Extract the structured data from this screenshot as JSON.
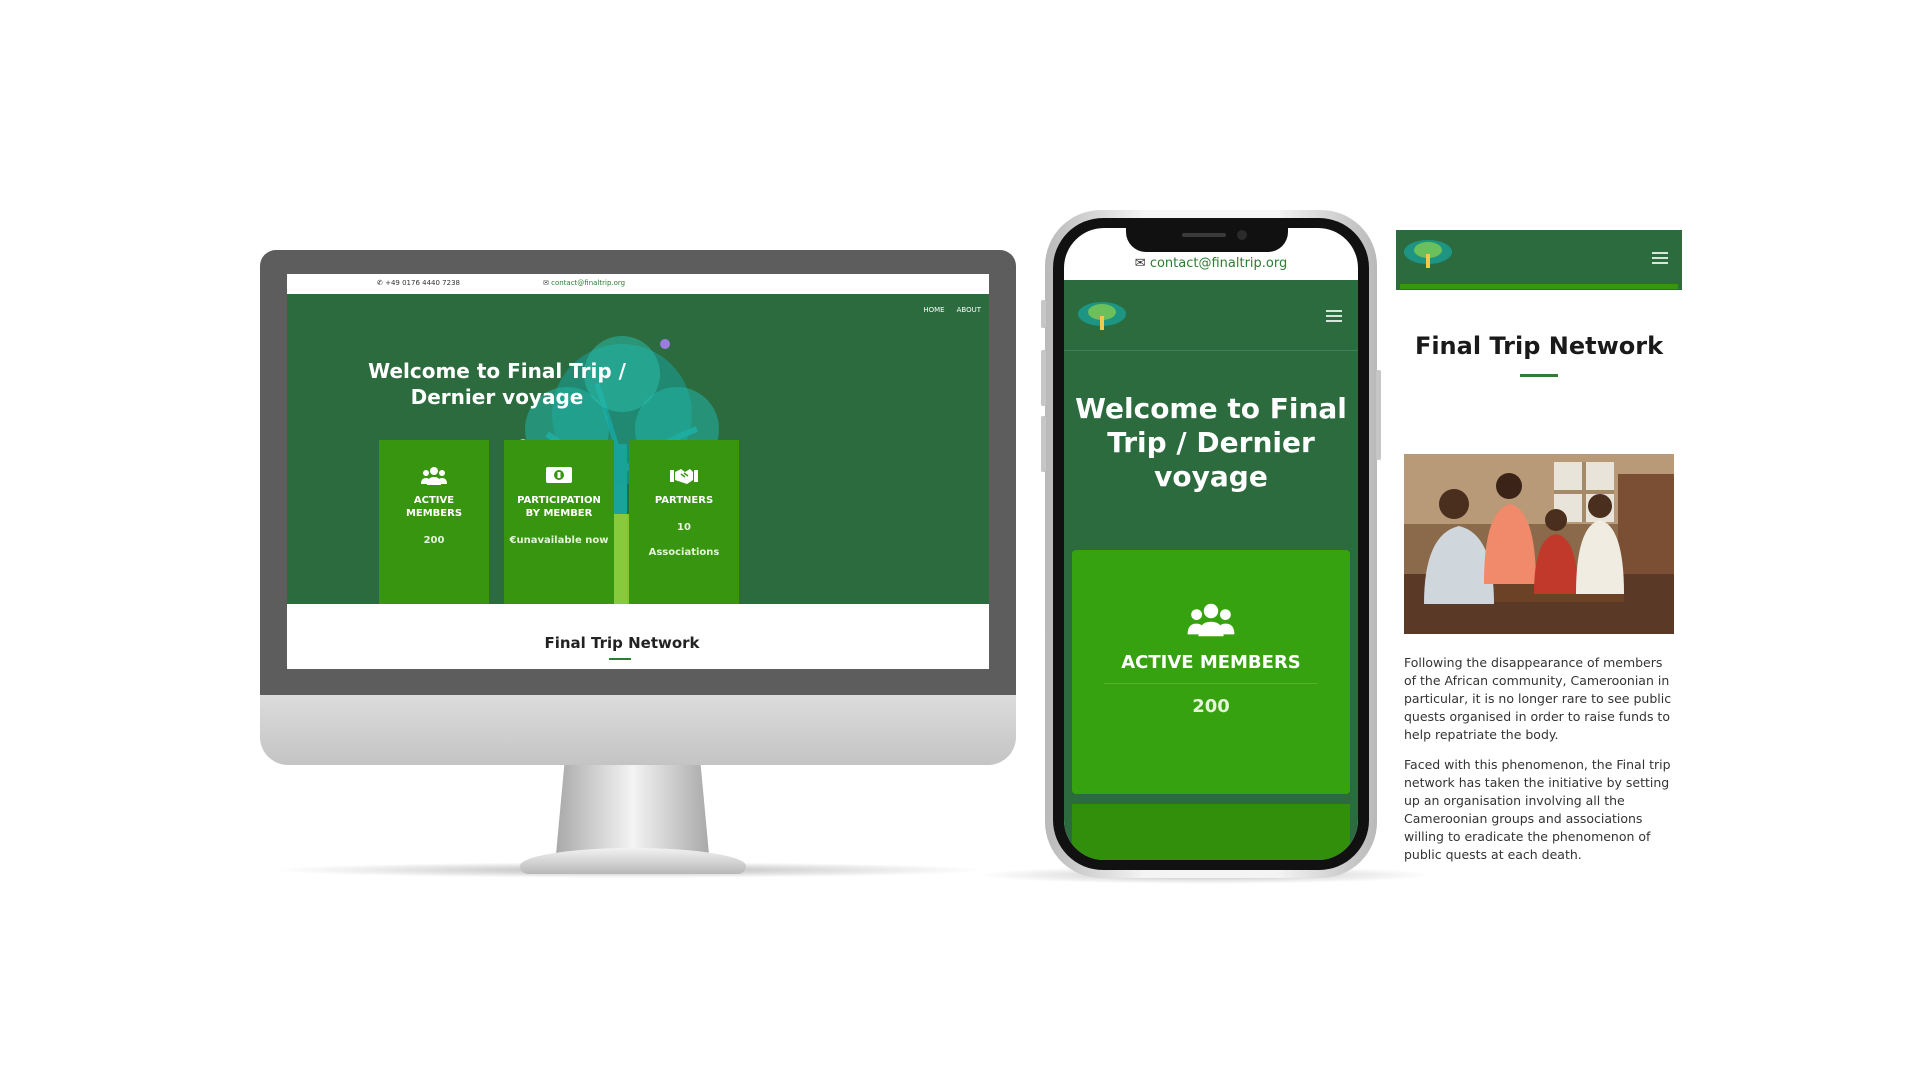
{
  "desktop": {
    "topbar": {
      "phone": "+49 0176 4440 7238",
      "email": "contact@finaltrip.org"
    },
    "nav": [
      "HOME",
      "ABOUT"
    ],
    "hero_title": "Welcome to Final Trip / Dernier voyage",
    "cards": [
      {
        "icon": "users-icon",
        "label": "ACTIVE MEMBERS",
        "value": "200"
      },
      {
        "icon": "money-icon",
        "label": "PARTICIPATION BY MEMBER",
        "value": "€unavailable now"
      },
      {
        "icon": "handshake-icon",
        "label": "PARTNERS",
        "value": "10",
        "value2": "Associations"
      }
    ],
    "section_title": "Final Trip Network"
  },
  "phone": {
    "email": "contact@finaltrip.org",
    "hero_title": "Welcome to Final Trip / Dernier voyage",
    "card": {
      "icon": "users-icon",
      "label": "ACTIVE MEMBERS",
      "value": "200"
    }
  },
  "mobile_page": {
    "title": "Final Trip Network",
    "paragraphs": [
      "Following the disappearance of members of the African community, Cameroonian in particular, it is no longer rare to see public quests organised in order to raise funds to help repatriate the body.",
      "Faced with this phenomenon, the Final trip network has taken the initiative by setting up an organisation involving all the Cameroonian groups and associations willing to eradicate the phenomenon of public quests at each death."
    ]
  },
  "colors": {
    "hero_green": "#2b6b3e",
    "card_green": "#37950f",
    "accent": "#2e7d32"
  }
}
